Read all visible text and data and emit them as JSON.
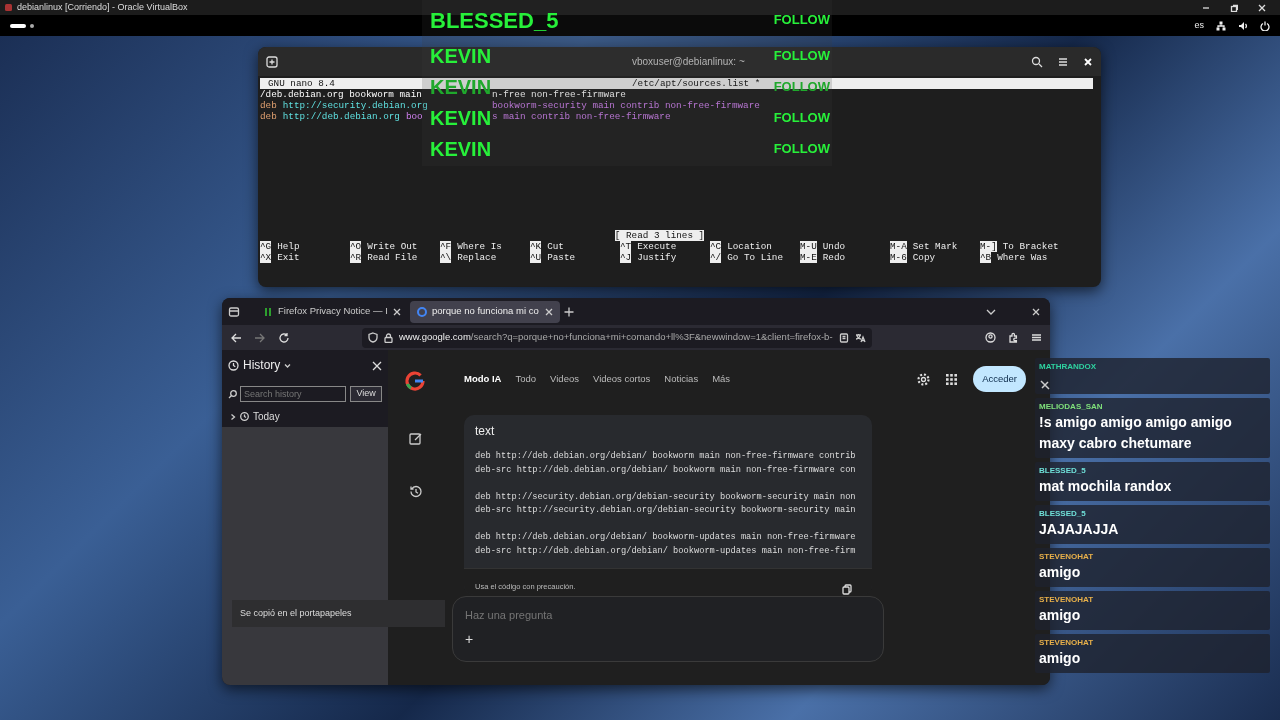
{
  "vm_window": {
    "title": "debianlinux [Corriendo] - Oracle VirtualBox"
  },
  "top_bar": {
    "keyboard_layout": "es"
  },
  "terminal": {
    "title": "vboxuser@debianlinux: ~",
    "nano": {
      "version": "GNU nano 8.4",
      "file": "/etc/apt/sources.list *",
      "lines": [
        {
          "left": [
            {
              "kind": "plain",
              "text": "/deb.debian.org bookworm main"
            }
          ],
          "right": [
            {
              "kind": "plain",
              "text": "n-free non-free-firmware"
            }
          ]
        },
        {
          "left": [
            {
              "kind": "keyword",
              "text": "deb"
            },
            {
              "kind": "url",
              "text": "http://security.debian.org"
            }
          ],
          "right": [
            {
              "kind": "option",
              "text": "bookworm-security main contrib non-free-firmware"
            }
          ]
        },
        {
          "left": [
            {
              "kind": "keyword",
              "text": "deb"
            },
            {
              "kind": "url",
              "text": "http://deb.debian.org"
            },
            {
              "kind": "option",
              "text": "boo"
            }
          ],
          "right": [
            {
              "kind": "option",
              "text": "s main contrib non-free-firmware"
            }
          ]
        }
      ],
      "status": "[ Read 3 lines ]",
      "shortcuts": [
        {
          "key": "^G",
          "label": "Help"
        },
        {
          "key": "^O",
          "label": "Write Out"
        },
        {
          "key": "^F",
          "label": "Where Is"
        },
        {
          "key": "^K",
          "label": "Cut"
        },
        {
          "key": "^T",
          "label": "Execute"
        },
        {
          "key": "^C",
          "label": "Location"
        },
        {
          "key": "M-U",
          "label": "Undo"
        },
        {
          "key": "M-A",
          "label": "Set Mark"
        },
        {
          "key": "M-]",
          "label": "To Bracket"
        },
        {
          "key": "^X",
          "label": "Exit"
        },
        {
          "key": "^R",
          "label": "Read File"
        },
        {
          "key": "^\\",
          "label": "Replace"
        },
        {
          "key": "^U",
          "label": "Paste"
        },
        {
          "key": "^J",
          "label": "Justify"
        },
        {
          "key": "^/",
          "label": "Go To Line"
        },
        {
          "key": "M-E",
          "label": "Redo"
        },
        {
          "key": "M-6",
          "label": "Copy"
        },
        {
          "key": "^B",
          "label": "Where Was"
        }
      ]
    }
  },
  "follow_alerts": [
    {
      "name": "BLESSED_5",
      "action": "FOLLOW",
      "faded": false
    },
    {
      "name": "KEVIN",
      "action": "FOLLOW",
      "faded": false
    },
    {
      "name": "KEVIN",
      "action": "FOLLOW",
      "faded": true
    },
    {
      "name": "KEVIN",
      "action": "FOLLOW",
      "faded": false
    },
    {
      "name": "KEVIN",
      "action": "FOLLOW",
      "faded": false
    }
  ],
  "browser": {
    "tabs": [
      {
        "label": "Firefox Privacy Notice — I",
        "selected": false
      },
      {
        "label": "porque no funciona mi co",
        "selected": true
      }
    ],
    "url": {
      "host": "www.google.com",
      "path": "/search?q=porque+no+funciona+mi+comando+ll%3F&newwindow=1&client=firefox-b-"
    },
    "sidebar": {
      "title": "History",
      "search": {
        "placeholder": "Search history"
      },
      "view_button": "View",
      "items": [
        {
          "label": "Today",
          "expanded": false
        }
      ]
    },
    "page": {
      "nav": [
        {
          "label": "Modo IA",
          "selected": true
        },
        {
          "label": "Todo",
          "selected": false
        },
        {
          "label": "Videos",
          "selected": false
        },
        {
          "label": "Videos cortos",
          "selected": false
        },
        {
          "label": "Noticias",
          "selected": false
        },
        {
          "label": "Más",
          "selected": false
        }
      ],
      "sign_in": "Acceder",
      "code_card": {
        "language": "text",
        "blocks": [
          [
            "deb http://deb.debian.org/debian/ bookworm main non-free-firmware contrib",
            "deb-src http://deb.debian.org/debian/ bookworm main non-free-firmware con"
          ],
          [
            "deb http://security.debian.org/debian-security bookworm-security main non",
            "deb-src http://security.debian.org/debian-security bookworm-security main"
          ],
          [
            "deb http://deb.debian.org/debian/ bookworm-updates main non-free-firmware",
            "deb-src http://deb.debian.org/debian/ bookworm-updates main non-free-firm"
          ]
        ],
        "note": "Usa el código con precaución."
      },
      "prompt": {
        "placeholder": "Haz una pregunta",
        "add": "+"
      },
      "toast": "Se copió en el portapapeles"
    }
  },
  "chat": [
    {
      "user": "MATHRANDOX",
      "color": "#2ed3a0",
      "emote": true
    },
    {
      "user": "MELIODAS_SAN",
      "color": "#7fe07a",
      "message": "!s amigo amigo amigo amigo maxy cabro chetumare",
      "emote": false
    },
    {
      "user": "BLESSED_5",
      "color": "#6fe0d8",
      "message": "mat mochila randox",
      "emote": false
    },
    {
      "user": "BLESSED_5",
      "color": "#6fe0d8",
      "message": "JAJAJAJJA",
      "emote": false
    },
    {
      "user": "STEVENOHAT",
      "color": "#e8b04a",
      "message": "amigo",
      "emote": false
    },
    {
      "user": "STEVENOHAT",
      "color": "#e8b04a",
      "message": "amigo",
      "emote": false
    },
    {
      "user": "STEVENOHAT",
      "color": "#e8b04a",
      "message": "amigo",
      "emote": false
    }
  ]
}
